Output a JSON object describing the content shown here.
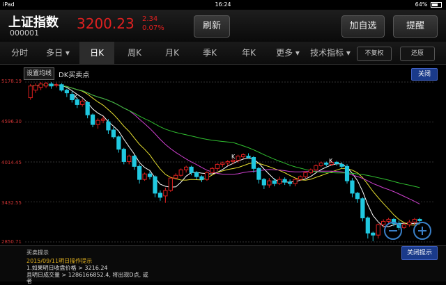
{
  "status": {
    "device": "iPad",
    "time": "16:24",
    "battery": "64%"
  },
  "header": {
    "name": "上证指数",
    "code": "000001",
    "price": "3200.23",
    "change": "2.34",
    "change_pct": "0.07%",
    "refresh": "刷新",
    "add_watch": "加自选",
    "remind": "提醒"
  },
  "tabs": [
    "分时",
    "多日 ▾",
    "日K",
    "周K",
    "月K",
    "季K",
    "年K",
    "更多 ▾",
    "技术指标 ▾"
  ],
  "active_tab": "日K",
  "adjust": {
    "no_adjust": "不复权",
    "restore": "还原"
  },
  "chart": {
    "set_ma": "设置均线",
    "indicator": "DK买卖点",
    "close": "关闭",
    "ylabels": [
      "5178.19",
      "4596.30",
      "4014.45",
      "3432.55",
      "2850.71"
    ],
    "marker": "K",
    "colors": {
      "up": "#e02020",
      "down": "#20c8e0",
      "ma5": "#ffffff",
      "ma10": "#e8e030",
      "ma20": "#d040d0",
      "ma60": "#30c030"
    }
  },
  "chart_data": {
    "type": "candlestick",
    "ylim": [
      2850.71,
      5178.19
    ],
    "candles": [
      [
        4950,
        5120,
        4920,
        5150
      ],
      [
        5060,
        5130,
        5020,
        5160
      ],
      [
        5100,
        5150,
        5060,
        5178
      ],
      [
        5120,
        5160,
        5090,
        5178
      ],
      [
        5150,
        5120,
        5080,
        5178
      ],
      [
        5130,
        5140,
        5100,
        5170
      ],
      [
        5140,
        5060,
        5040,
        5160
      ],
      [
        5060,
        5020,
        4960,
        5080
      ],
      [
        5000,
        4920,
        4880,
        5040
      ],
      [
        4920,
        4850,
        4800,
        4950
      ],
      [
        4850,
        4900,
        4820,
        4930
      ],
      [
        4880,
        4700,
        4650,
        4900
      ],
      [
        4700,
        4560,
        4520,
        4720
      ],
      [
        4560,
        4620,
        4500,
        4650
      ],
      [
        4620,
        4640,
        4580,
        4680
      ],
      [
        4600,
        4480,
        4420,
        4640
      ],
      [
        4480,
        4380,
        4350,
        4520
      ],
      [
        4380,
        4200,
        4150,
        4400
      ],
      [
        4200,
        4020,
        3980,
        4220
      ],
      [
        4020,
        4100,
        3980,
        4120
      ],
      [
        4100,
        3950,
        3900,
        4120
      ],
      [
        3950,
        3760,
        3700,
        3980
      ],
      [
        3760,
        3840,
        3740,
        3860
      ],
      [
        3840,
        3800,
        3760,
        3880
      ],
      [
        3800,
        3560,
        3500,
        3820
      ],
      [
        3560,
        3500,
        3450,
        3600
      ],
      [
        3520,
        3600,
        3420,
        3640
      ],
      [
        3600,
        3780,
        3580,
        3800
      ],
      [
        3780,
        3820,
        3760,
        3850
      ],
      [
        3820,
        3900,
        3800,
        3920
      ],
      [
        3900,
        3940,
        3860,
        3960
      ],
      [
        3940,
        3860,
        3820,
        3960
      ],
      [
        3860,
        3800,
        3760,
        3880
      ],
      [
        3800,
        3760,
        3720,
        3820
      ],
      [
        3760,
        3860,
        3740,
        3880
      ],
      [
        3860,
        3920,
        3840,
        3940
      ],
      [
        3920,
        3980,
        3880,
        4000
      ],
      [
        3980,
        4000,
        3940,
        4020
      ],
      [
        4000,
        4020,
        3960,
        4040
      ],
      [
        4020,
        4040,
        3980,
        4060
      ],
      [
        4040,
        4100,
        4000,
        4120
      ],
      [
        4090,
        4120,
        4060,
        4140
      ],
      [
        4100,
        4080,
        4060,
        4140
      ],
      [
        4080,
        3920,
        3860,
        4100
      ],
      [
        3920,
        3760,
        3700,
        3940
      ],
      [
        3760,
        3680,
        3620,
        3780
      ],
      [
        3680,
        3740,
        3640,
        3780
      ],
      [
        3740,
        3700,
        3660,
        3780
      ],
      [
        3700,
        3760,
        3680,
        3800
      ],
      [
        3760,
        3720,
        3680,
        3790
      ],
      [
        3720,
        3700,
        3660,
        3760
      ],
      [
        3700,
        3760,
        3660,
        3780
      ],
      [
        3760,
        3800,
        3740,
        3820
      ],
      [
        3800,
        3860,
        3780,
        3880
      ],
      [
        3860,
        3900,
        3840,
        3920
      ],
      [
        3900,
        3960,
        3880,
        3980
      ],
      [
        3960,
        4000,
        3940,
        4020
      ],
      [
        4000,
        3980,
        3950,
        4020
      ],
      [
        3980,
        4010,
        3960,
        4040
      ],
      [
        4010,
        3990,
        3960,
        4030
      ],
      [
        3980,
        3950,
        3920,
        4010
      ],
      [
        3950,
        3740,
        3700,
        3980
      ],
      [
        3740,
        3560,
        3500,
        3780
      ],
      [
        3560,
        3480,
        3420,
        3580
      ],
      [
        3480,
        3200,
        3150,
        3500
      ],
      [
        3200,
        2980,
        2900,
        3220
      ],
      [
        2980,
        2950,
        2860,
        3000
      ],
      [
        2950,
        3100,
        2900,
        3120
      ],
      [
        3100,
        3150,
        3060,
        3180
      ],
      [
        3150,
        3180,
        3100,
        3200
      ],
      [
        3180,
        3120,
        3080,
        3200
      ],
      [
        3120,
        3060,
        3020,
        3160
      ],
      [
        3060,
        3100,
        3040,
        3130
      ],
      [
        3100,
        3140,
        3070,
        3170
      ],
      [
        3140,
        3180,
        3100,
        3200
      ],
      [
        3180,
        3160,
        3120,
        3200
      ]
    ]
  },
  "tips": {
    "title": "买卖提示",
    "date_line": "2015/09/11明日操作提示",
    "line1": "1.如果明日收盘价格 > 3216.24",
    "line2": "且明日成交量 > 1286166852.4,  将出现D点, 或",
    "line3": "者",
    "close": "关闭提示"
  }
}
